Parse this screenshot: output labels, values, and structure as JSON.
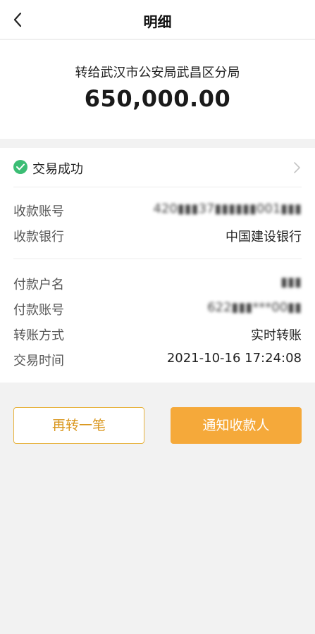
{
  "header": {
    "title": "明细",
    "back_icon": "chevron-left-icon"
  },
  "summary": {
    "payee": "转给武汉市公安局武昌区分局",
    "amount": "650,000.00"
  },
  "status": {
    "label": "交易成功",
    "icon": "check-circle-icon",
    "color": "#3bbd74"
  },
  "payee_details": [
    {
      "label": "收款账号",
      "value": "420▮▮▮37▮▮▮▮▮▮001▮▮▮",
      "blurred": true
    },
    {
      "label": "收款银行",
      "value": "中国建设银行",
      "blurred": false
    }
  ],
  "payer_details": [
    {
      "label": "付款户名",
      "value": "▮▮▮",
      "blurred": true
    },
    {
      "label": "付款账号",
      "value": "622▮▮▮***00▮▮",
      "blurred": true
    },
    {
      "label": "转账方式",
      "value": "实时转账",
      "blurred": false
    },
    {
      "label": "交易时间",
      "value": "2021-10-16 17:24:08",
      "blurred": false
    }
  ],
  "actions": {
    "again_label": "再转一笔",
    "notify_label": "通知收款人"
  },
  "colors": {
    "accent": "#f5a93a",
    "accent_text": "#d9961c",
    "success": "#3bbd74"
  }
}
